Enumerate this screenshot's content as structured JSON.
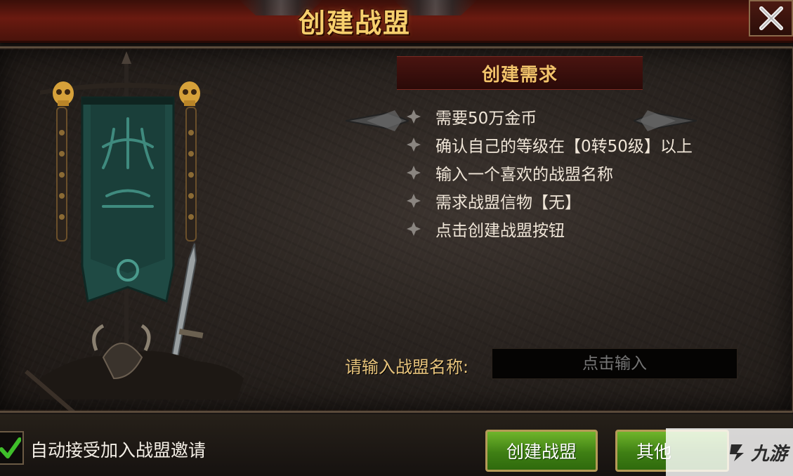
{
  "window": {
    "title": "创建战盟",
    "close_label": "×"
  },
  "requirements": {
    "header": "创建需求",
    "items": [
      "需要50万金币",
      "确认自己的等级在【0转50级】以上",
      "输入一个喜欢的战盟名称",
      "需求战盟信物【无】",
      "点击创建战盟按钮"
    ]
  },
  "name_input": {
    "label": "请输入战盟名称:",
    "placeholder": "点击输入",
    "value": ""
  },
  "footer": {
    "auto_accept_label": "自动接受加入战盟邀请",
    "auto_accept_checked": true,
    "create_button": "创建战盟",
    "other_button": "其他"
  },
  "watermark": "九游",
  "colors": {
    "title_gold": "#f6cf6d",
    "header_gold": "#f2c36b",
    "button_green": "#4f9a1c",
    "check_green": "#3fbf2a",
    "banner_teal": "#1f4a44"
  }
}
